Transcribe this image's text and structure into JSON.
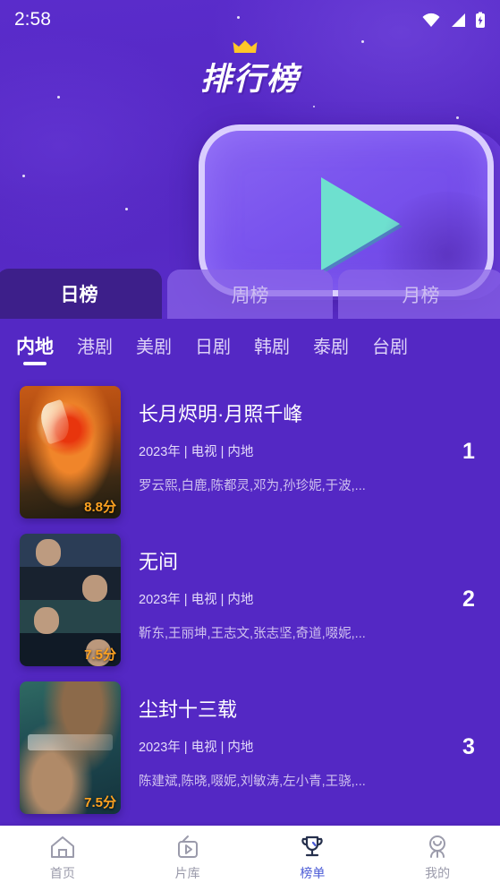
{
  "status_bar": {
    "time": "2:58",
    "icons": [
      "wifi-icon",
      "signal-icon",
      "battery-icon"
    ]
  },
  "hero": {
    "logo_text": "排行榜",
    "crown_icon": "crown-icon",
    "play_icon": "play-triangle-icon"
  },
  "period_tabs": [
    {
      "label": "日榜",
      "active": true
    },
    {
      "label": "周榜",
      "active": false
    },
    {
      "label": "月榜",
      "active": false
    }
  ],
  "categories": [
    {
      "label": "内地",
      "active": true
    },
    {
      "label": "港剧",
      "active": false
    },
    {
      "label": "美剧",
      "active": false
    },
    {
      "label": "日剧",
      "active": false
    },
    {
      "label": "韩剧",
      "active": false
    },
    {
      "label": "泰剧",
      "active": false
    },
    {
      "label": "台剧",
      "active": false
    }
  ],
  "list": [
    {
      "title": "长月烬明·月照千峰",
      "meta": "2023年 | 电视 | 内地",
      "cast": "罗云熙,白鹿,陈都灵,邓为,孙珍妮,于波,...",
      "score": "8.8分",
      "rank": "1"
    },
    {
      "title": "无间",
      "meta": "2023年 | 电视 | 内地",
      "cast": "靳东,王丽坤,王志文,张志坚,奇道,啜妮,...",
      "score": "7.5分",
      "rank": "2"
    },
    {
      "title": "尘封十三载",
      "meta": "2023年 | 电视 | 内地",
      "cast": "陈建斌,陈晓,啜妮,刘敏涛,左小青,王骁,...",
      "score": "7.5分",
      "rank": "3"
    }
  ],
  "bottom_nav": [
    {
      "label": "首页",
      "icon": "home-icon",
      "active": false
    },
    {
      "label": "片库",
      "icon": "tv-icon",
      "active": false
    },
    {
      "label": "榜单",
      "icon": "trophy-icon",
      "active": true
    },
    {
      "label": "我的",
      "icon": "person-icon",
      "active": false
    }
  ],
  "colors": {
    "background": "#5428C4",
    "tab_active": "#3D1F8A",
    "score": "#FFA320",
    "nav_active": "#4B5BD6",
    "play_triangle": "#6EE0CF"
  }
}
